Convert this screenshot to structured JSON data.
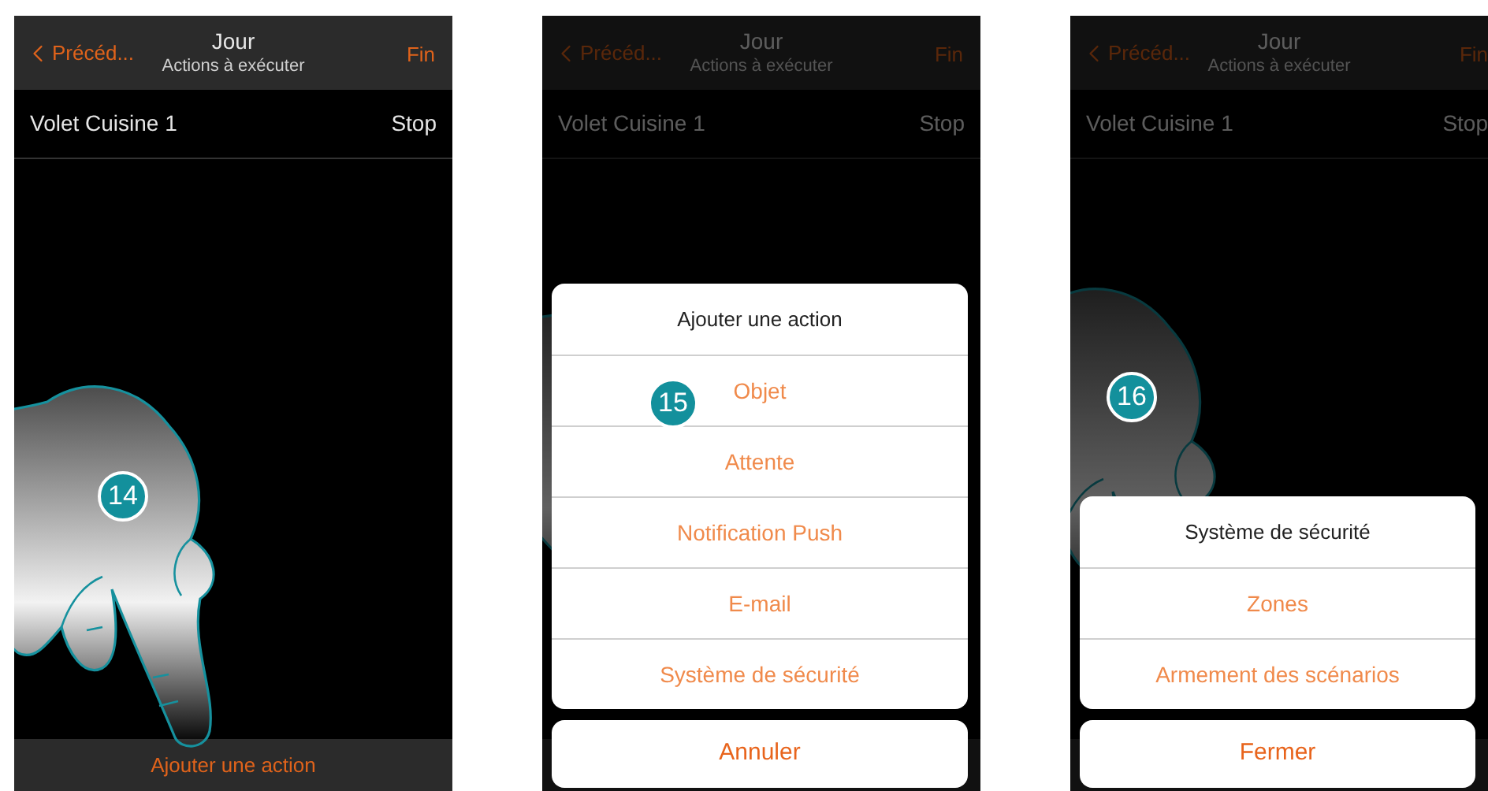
{
  "phones": [
    {
      "dimmed": false,
      "back": "Précéd...",
      "title": "Jour",
      "subtitle": "Actions à exécuter",
      "done": "Fin",
      "row": {
        "label": "Volet Cuisine 1",
        "value": "Stop"
      },
      "bottom_action": "Ajouter une action",
      "step": "14"
    },
    {
      "dimmed": true,
      "back": "Précéd...",
      "title": "Jour",
      "subtitle": "Actions à exécuter",
      "done": "Fin",
      "row": {
        "label": "Volet Cuisine 1",
        "value": "Stop"
      },
      "sheet": {
        "title": "Ajouter une action",
        "items": [
          "Objet",
          "Attente",
          "Notification Push",
          "E-mail",
          "Système de sécurité"
        ],
        "cancel": "Annuler"
      },
      "step": "15"
    },
    {
      "dimmed": true,
      "back": "Précéd...",
      "title": "Jour",
      "subtitle": "Actions à exécuter",
      "done": "Fin",
      "row": {
        "label": "Volet Cuisine 1",
        "value": "Stop"
      },
      "sheet": {
        "title": "Système de sécurité",
        "items": [
          "Zones",
          "Armement des scénarios"
        ],
        "cancel": "Fermer"
      },
      "step": "16"
    }
  ]
}
